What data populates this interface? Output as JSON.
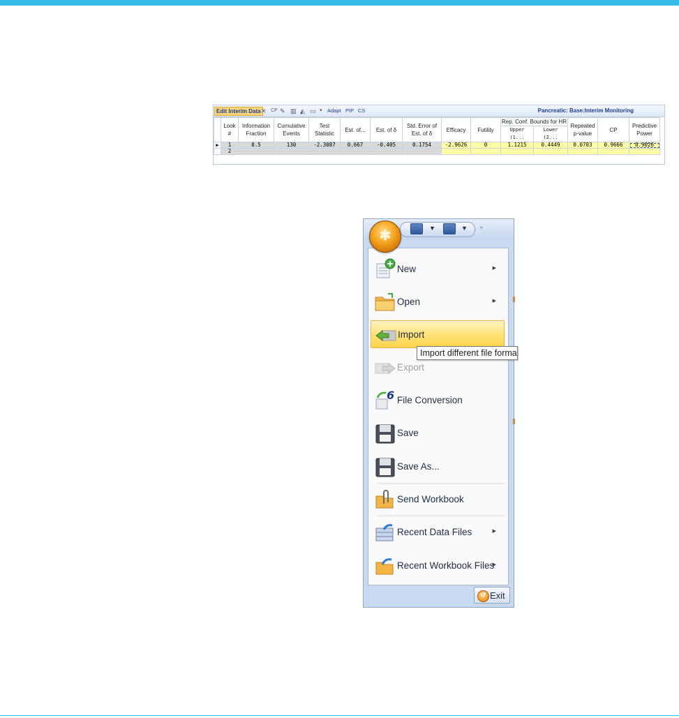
{
  "colors": {
    "accent_bar": "#35b7e8",
    "highlight": "#ffd34a",
    "grey_cell": "#d9d9d9",
    "yellow_cell": "#ffffa6"
  },
  "grid": {
    "toolbar": {
      "edit_interim_data": "Edit Interim Data",
      "close_icon": "close-icon",
      "cp_icon": "CP",
      "adapt": "Adapt",
      "pip": "PIP",
      "cs": "CS",
      "title": "Pancreatic: Base:Interim Monitoring"
    },
    "headers": {
      "look": "Look #",
      "info_fraction": "Information Fraction",
      "cum_events": "Cumulative Events",
      "test_stat": "Test Statistic",
      "est_of": "Est. of...",
      "est_delta": "Est. of δ",
      "std_error": "Std. Error of Est. of δ",
      "efficacy": "Efficacy",
      "futility": "Futility",
      "rep_conf": "Rep. Conf. Bounds for HR",
      "upper": "Upper (1...",
      "lower": "Lower (2...",
      "repeated_p": "Repeated p-value",
      "cp": "CP",
      "predictive_power": "Predictive Power"
    },
    "rows": [
      {
        "look": "1",
        "info_fraction": "0.5",
        "cum_events": "130",
        "test_stat": "-2.3087",
        "est_of": "0.667",
        "est_delta": "-0.405",
        "std_error": "0.1754",
        "efficacy": "-2.9626",
        "futility": "0",
        "upper": "1.1215",
        "lower": "0.4449",
        "repeated_p": "0.0703",
        "cp": "0.9666",
        "predictive_power": "0.9026"
      },
      {
        "look": "2",
        "info_fraction": "",
        "cum_events": "",
        "test_stat": "",
        "est_of": "",
        "est_delta": "",
        "std_error": "",
        "efficacy": "",
        "futility": "",
        "upper": "",
        "lower": "",
        "repeated_p": "",
        "cp": "",
        "predictive_power": ""
      }
    ]
  },
  "menu": {
    "items": [
      {
        "label": "New",
        "icon": "new-document-icon",
        "submenu": true
      },
      {
        "label": "Open",
        "icon": "open-folder-icon",
        "submenu": true
      },
      {
        "label": "Import",
        "icon": "import-arrow-icon",
        "highlighted": true
      },
      {
        "label": "Export",
        "icon": "export-arrow-icon",
        "disabled": true
      },
      {
        "label": "File Conversion",
        "icon": "file-conversion-icon"
      },
      {
        "label": "Save",
        "icon": "floppy-disk-icon"
      },
      {
        "label": "Save As...",
        "icon": "floppy-disk-save-as-icon"
      },
      {
        "label": "Send Workbook",
        "icon": "paperclip-folder-icon"
      },
      {
        "label": "Recent Data Files",
        "icon": "recent-data-files-icon",
        "submenu": true
      },
      {
        "label": "Recent Workbook Files",
        "icon": "recent-workbook-files-icon",
        "submenu": true
      }
    ],
    "tooltip": "Import different file formats",
    "exit_label": "Exit"
  }
}
